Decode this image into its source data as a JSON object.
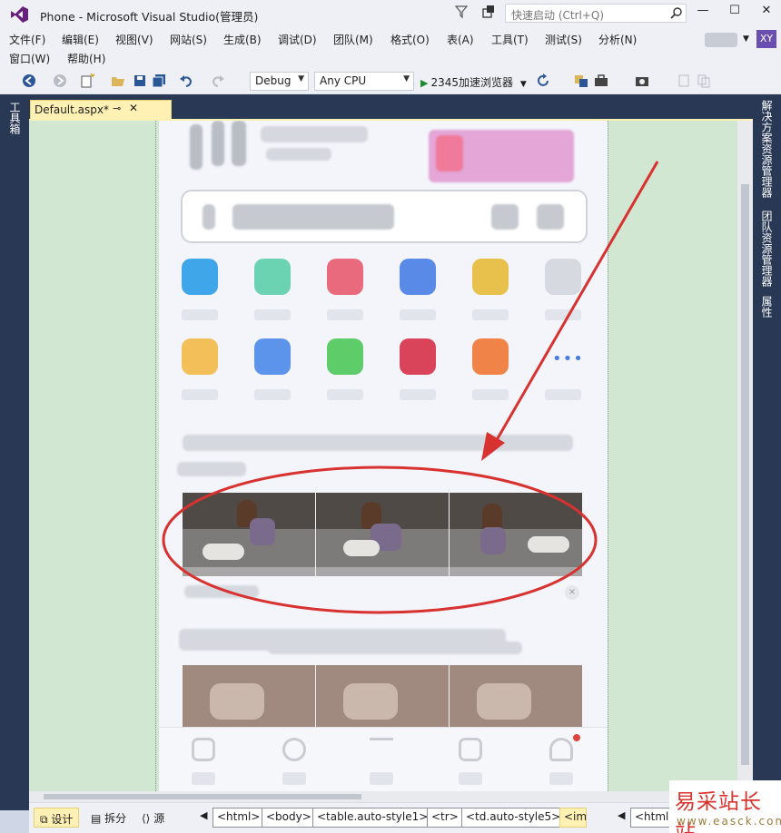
{
  "window": {
    "title": "Phone - Microsoft Visual Studio(管理员)",
    "quick_launch_placeholder": "快速启动 (Ctrl+Q)",
    "user_initials": "XY",
    "accent": "#293955"
  },
  "menu": {
    "row1": [
      "文件(F)",
      "编辑(E)",
      "视图(V)",
      "网站(S)",
      "生成(B)",
      "调试(D)",
      "团队(M)",
      "格式(O)",
      "表(A)",
      "工具(T)",
      "测试(S)",
      "分析(N)"
    ],
    "row2": [
      "窗口(W)",
      "帮助(H)"
    ]
  },
  "toolbar": {
    "config": "Debug",
    "platform": "Any CPU",
    "run_target": "2345加速浏览器"
  },
  "left_strip": {
    "toolbox": "工具箱"
  },
  "right_strip": {
    "solution_explorer": "解决方案资源管理器",
    "team_explorer": "团队资源管理器",
    "properties": "属性"
  },
  "document": {
    "tab_name": "Default.aspx*",
    "tab_close": "✕",
    "tab_pin": "⊸"
  },
  "phone": {
    "feed_close": "×"
  },
  "bottom": {
    "views": [
      "设计",
      "拆分",
      "源"
    ],
    "crumbs": [
      "<html>",
      "<body>",
      "<table.auto-style1>",
      "<tr>",
      "<td.auto-style5>",
      "<im"
    ],
    "crumbs_right": [
      "<html>"
    ]
  },
  "watermark": {
    "main": "易采站长站",
    "sub": "www.easck.com"
  }
}
